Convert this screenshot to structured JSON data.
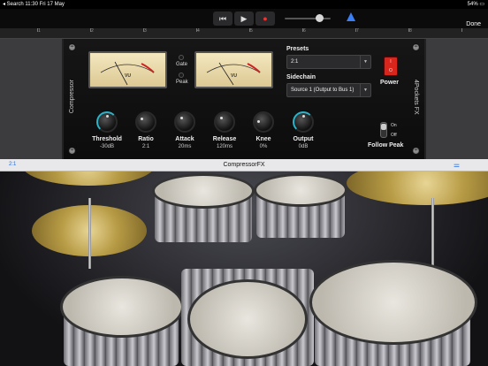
{
  "status": {
    "left": "◂ Search  11:30  Fri 17 May",
    "right": "54% ▭"
  },
  "toolbar": {
    "rewind": "⏮",
    "play": "▶",
    "record": "●",
    "done": "Done",
    "metronome_icon": "metronome-icon"
  },
  "ruler": {
    "marks": [
      "1",
      "2",
      "3",
      "4",
      "5",
      "6",
      "7",
      "8"
    ]
  },
  "plugin": {
    "left_label": "Compressor",
    "right_label": "4Pockets FX",
    "vu_label": "VU",
    "gate_label": "Gate",
    "peak_label": "Peak",
    "presets_title": "Presets",
    "preset_value": "2:1",
    "sidechain_title": "Sidechain",
    "sidechain_value": "Source 1 (Output to Bus 1)",
    "power_label": "Power",
    "power_on": "I",
    "power_off": "O",
    "on_label": "On",
    "off_label": "Off",
    "follow_peak_label": "Follow Peak",
    "knobs": [
      {
        "label": "Threshold",
        "value": "-30dB"
      },
      {
        "label": "Ratio",
        "value": "2:1"
      },
      {
        "label": "Attack",
        "value": "20ms"
      },
      {
        "label": "Release",
        "value": "120ms"
      },
      {
        "label": "Knee",
        "value": "0%"
      },
      {
        "label": "Output",
        "value": "0dB"
      }
    ]
  },
  "namebar": {
    "preset": "2:1",
    "title": "CompressorFX",
    "settings_icon": "sliders-icon"
  },
  "colors": {
    "accent": "#2a6ad6",
    "record": "#e33333",
    "power": "#d9261c",
    "knob_ring": "#2bb3c8"
  }
}
